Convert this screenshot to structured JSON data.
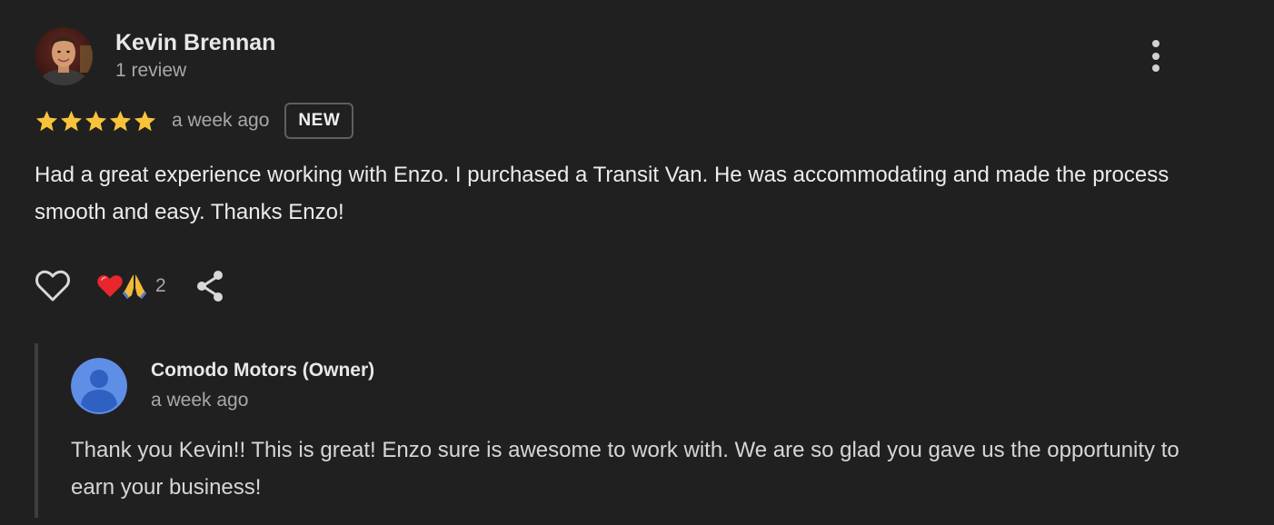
{
  "review": {
    "author": {
      "name": "Kevin Brennan",
      "review_count": "1 review",
      "avatar_icon": "person-photo"
    },
    "rating": 5,
    "max_rating": 5,
    "star_color": "#f7c33b",
    "time": "a week ago",
    "badge": "NEW",
    "text": "Had a great experience working with Enzo. I purchased a Transit Van. He was accommodating and made the process smooth and easy. Thanks Enzo!",
    "actions": {
      "like_icon": "heart-outline-icon",
      "reactions": [
        "❤️",
        "🙏"
      ],
      "reaction_count": "2",
      "share_icon": "share-icon",
      "more_icon": "more-vertical-icon"
    }
  },
  "reply": {
    "author": "Comodo Motors (Owner)",
    "avatar_icon": "default-person-icon",
    "avatar_color": "#5f8ee6",
    "time": "a week ago",
    "text": "Thank you Kevin!! This is great! Enzo sure is awesome to work with. We are so glad you gave us the opportunity to earn your business!"
  }
}
